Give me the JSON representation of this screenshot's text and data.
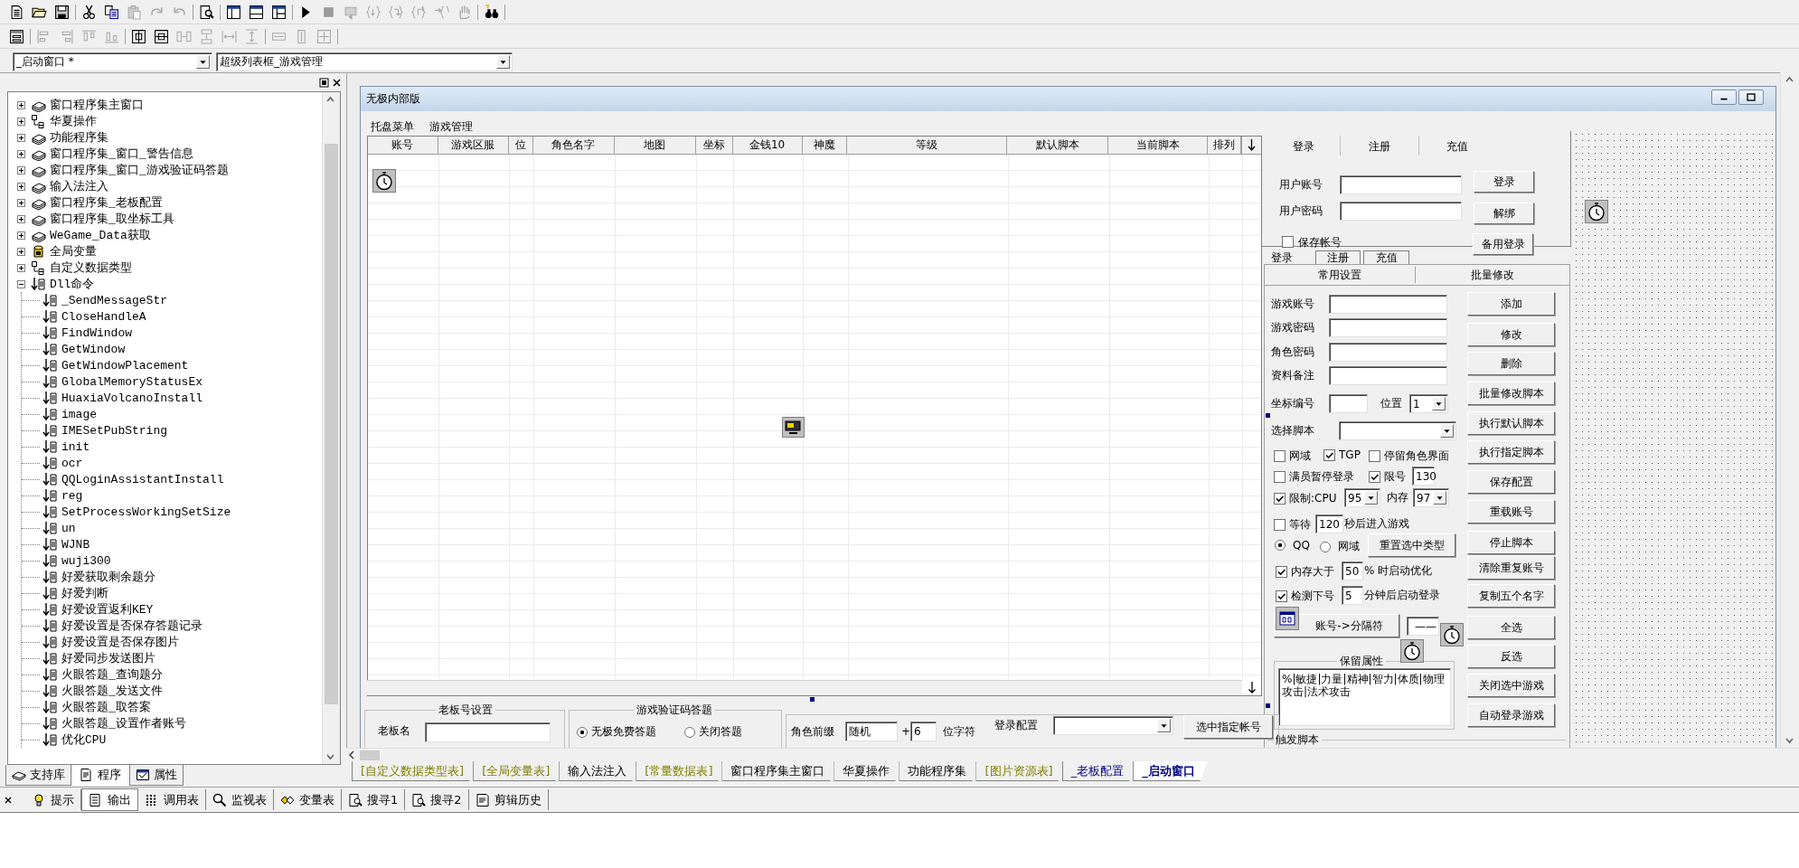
{
  "toolbars": [
    {
      "groups": [
        [
          {
            "kind": "new",
            "disabled": false
          },
          {
            "kind": "open",
            "disabled": false
          },
          {
            "kind": "save",
            "disabled": false
          }
        ],
        [
          {
            "kind": "cut",
            "disabled": false
          },
          {
            "kind": "copy",
            "disabled": false
          },
          {
            "kind": "paste",
            "disabled": true
          },
          {
            "kind": "redo",
            "disabled": true
          },
          {
            "kind": "undo",
            "disabled": true
          }
        ],
        [
          {
            "kind": "preview",
            "disabled": false
          }
        ],
        [
          {
            "kind": "layout-left",
            "disabled": false
          },
          {
            "kind": "layout-top",
            "disabled": false
          },
          {
            "kind": "layout-split",
            "disabled": false
          }
        ],
        [
          {
            "kind": "run",
            "disabled": false
          },
          {
            "kind": "stop",
            "disabled": true
          },
          {
            "kind": "step",
            "disabled": true
          },
          {
            "kind": "step-into",
            "disabled": true
          },
          {
            "kind": "step-over",
            "disabled": true
          },
          {
            "kind": "step-out",
            "disabled": true
          },
          {
            "kind": "run-to",
            "disabled": true
          },
          {
            "kind": "hand",
            "disabled": true
          }
        ],
        [
          {
            "kind": "find",
            "disabled": false
          }
        ]
      ]
    },
    {
      "groups": [
        [
          {
            "kind": "form",
            "disabled": false
          }
        ],
        [
          {
            "kind": "align-left",
            "disabled": true
          },
          {
            "kind": "align-right",
            "disabled": true
          },
          {
            "kind": "align-top",
            "disabled": true
          },
          {
            "kind": "align-bottom",
            "disabled": true
          }
        ],
        [
          {
            "kind": "center-h",
            "disabled": false
          },
          {
            "kind": "center-v",
            "disabled": false
          },
          {
            "kind": "space-h",
            "disabled": true
          },
          {
            "kind": "space-v",
            "disabled": true
          },
          {
            "kind": "gap-h",
            "disabled": true
          },
          {
            "kind": "gap-v",
            "disabled": true
          }
        ],
        [
          {
            "kind": "same-width",
            "disabled": true
          },
          {
            "kind": "same-height",
            "disabled": true
          },
          {
            "kind": "same-size",
            "disabled": true
          }
        ]
      ]
    }
  ],
  "object_selector": {
    "value": "_启动窗口 *"
  },
  "member_selector": {
    "value": "超级列表框_游戏管理"
  },
  "tree": [
    {
      "label": "窗口程序集主窗口",
      "kind": "module",
      "expanded": false
    },
    {
      "label": "华夏操作",
      "kind": "class",
      "expanded": false
    },
    {
      "label": "功能程序集",
      "kind": "module",
      "expanded": false
    },
    {
      "label": "窗口程序集_窗口_警告信息",
      "kind": "module",
      "expanded": false
    },
    {
      "label": "窗口程序集_窗口_游戏验证码答题",
      "kind": "module",
      "expanded": false
    },
    {
      "label": "输入法注入",
      "kind": "module",
      "expanded": false
    },
    {
      "label": "窗口程序集_老板配置",
      "kind": "module",
      "expanded": false
    },
    {
      "label": "窗口程序集_取坐标工具",
      "kind": "module",
      "expanded": false
    },
    {
      "label": "WeGame_Data获取",
      "kind": "module",
      "expanded": false
    },
    {
      "label": "全局变量",
      "kind": "global",
      "expanded": false
    },
    {
      "label": "自定义数据类型",
      "kind": "class",
      "expanded": false
    },
    {
      "label": "Dll命令",
      "kind": "dll",
      "expanded": true,
      "children": [
        {
          "label": "_SendMessageStr",
          "kind": "dll-command"
        },
        {
          "label": "CloseHandleA",
          "kind": "dll-command"
        },
        {
          "label": "FindWindow",
          "kind": "dll-command"
        },
        {
          "label": "GetWindow",
          "kind": "dll-command"
        },
        {
          "label": "GetWindowPlacement",
          "kind": "dll-command"
        },
        {
          "label": "GlobalMemoryStatusEx",
          "kind": "dll-command"
        },
        {
          "label": "HuaxiaVolcanoInstall",
          "kind": "dll-command"
        },
        {
          "label": "image",
          "kind": "dll-command"
        },
        {
          "label": "IMESetPubString",
          "kind": "dll-command"
        },
        {
          "label": "init",
          "kind": "dll-command"
        },
        {
          "label": "ocr",
          "kind": "dll-command"
        },
        {
          "label": "QQLoginAssistantInstall",
          "kind": "dll-command"
        },
        {
          "label": "reg",
          "kind": "dll-command"
        },
        {
          "label": "SetProcessWorkingSetSize",
          "kind": "dll-command"
        },
        {
          "label": "un",
          "kind": "dll-command"
        },
        {
          "label": "WJNB",
          "kind": "dll-command"
        },
        {
          "label": "wuji300",
          "kind": "dll-command"
        },
        {
          "label": "好爱获取剩余题分",
          "kind": "dll-command"
        },
        {
          "label": "好爱判断",
          "kind": "dll-command"
        },
        {
          "label": "好爱设置返利KEY",
          "kind": "dll-command"
        },
        {
          "label": "好爱设置是否保存答题记录",
          "kind": "dll-command"
        },
        {
          "label": "好爱设置是否保存图片",
          "kind": "dll-command"
        },
        {
          "label": "好爱同步发送图片",
          "kind": "dll-command"
        },
        {
          "label": "火眼答题_查询题分",
          "kind": "dll-command"
        },
        {
          "label": "火眼答题_发送文件",
          "kind": "dll-command"
        },
        {
          "label": "火眼答题_取答案",
          "kind": "dll-command"
        },
        {
          "label": "火眼答题_设置作者账号",
          "kind": "dll-command"
        },
        {
          "label": "优化CPU",
          "kind": "dll-command"
        }
      ]
    }
  ],
  "left_tabs": [
    {
      "label": "支持库",
      "kind": "library",
      "selected": false
    },
    {
      "label": "程序",
      "kind": "program",
      "selected": true
    },
    {
      "label": "属性",
      "kind": "properties",
      "selected": false
    }
  ],
  "form": {
    "title": "无极内部版",
    "menu": [
      "托盘菜单",
      "游戏管理"
    ],
    "list": {
      "columns": [
        "账号",
        "游戏区服",
        "位",
        "角色名字",
        "地图",
        "坐标",
        "金钱10",
        "神魔",
        "等级",
        "默认脚本",
        "当前脚本",
        "排列"
      ]
    },
    "login_panel": {
      "tabs": [
        "登录",
        "注册",
        "充值"
      ],
      "fields": [
        {
          "label": "用户账号"
        },
        {
          "label": "用户密码"
        }
      ],
      "buttons": [
        "登录",
        "解绑",
        "备用登录"
      ],
      "remember": {
        "label": "保存帐号",
        "checked": false
      },
      "mini_tabs": [
        {
          "label": "登录",
          "selected": true
        },
        {
          "label": "注册",
          "selected": false
        },
        {
          "label": "充值",
          "selected": false
        }
      ]
    },
    "settings_panel": {
      "tabs": [
        "常用设置",
        "批量修改"
      ],
      "fields": [
        {
          "label": "游戏账号"
        },
        {
          "label": "游戏密码"
        },
        {
          "label": "角色密码"
        },
        {
          "label": "资料备注"
        }
      ],
      "coord": {
        "label": "坐标编号",
        "position_label": "位置",
        "position_value": "1"
      },
      "script": {
        "label": "选择脚本"
      },
      "options": [
        {
          "kind": "checkbox",
          "label": "网域",
          "checked": false
        },
        {
          "kind": "checkbox",
          "label": "TGP",
          "checked": true
        },
        {
          "kind": "checkbox",
          "label": "停留角色界面",
          "checked": false
        },
        {
          "kind": "checkbox",
          "label": "满员暂停登录",
          "checked": false
        },
        {
          "kind": "checkbox",
          "label": "限号",
          "checked": true
        },
        {
          "kind": "field",
          "value": "130"
        },
        {
          "kind": "checkbox",
          "label": "限制:CPU",
          "checked": true
        },
        {
          "kind": "combo",
          "value": "95"
        },
        {
          "kind": "label",
          "label": "内存"
        },
        {
          "kind": "combo",
          "value": "97"
        },
        {
          "kind": "checkbox",
          "label": "等待",
          "checked": false
        },
        {
          "kind": "field",
          "value": "120"
        },
        {
          "kind": "label",
          "label": "秒后进入游戏"
        },
        {
          "kind": "radio",
          "label": "QQ",
          "selected": true
        },
        {
          "kind": "radio",
          "label": "网域",
          "selected": false
        },
        {
          "kind": "button",
          "label": "重置选中类型"
        },
        {
          "kind": "checkbox",
          "label": "内存大于",
          "checked": true
        },
        {
          "kind": "field",
          "value": "50"
        },
        {
          "kind": "label",
          "label": "% 时启动优化"
        },
        {
          "kind": "checkbox",
          "label": "检测下号",
          "checked": true
        },
        {
          "kind": "field",
          "value": "5"
        },
        {
          "kind": "label",
          "label": "分钟后启动登录"
        },
        {
          "kind": "button",
          "label": "账号->分隔符"
        },
        {
          "kind": "field",
          "value": "——"
        }
      ],
      "keep_group": {
        "title": "保留属性",
        "text": "%|敏捷|力量|精神|智力|体质|物理攻击|法术攻击"
      },
      "trigger_group": {
        "title": "触发脚本"
      },
      "buttons": [
        "添加",
        "修改",
        "删除",
        "批量修改脚本",
        "执行默认脚本",
        "执行指定脚本",
        "保存配置",
        "重载账号",
        "停止脚本",
        "清除重复账号",
        "复制五个名字",
        "全选",
        "反选",
        "关闭选中游戏",
        "自动登录游戏"
      ]
    },
    "boss_group": {
      "title": "老板号设置",
      "label": "老板名"
    },
    "captcha_group": {
      "title": "游戏验证码答题",
      "options": [
        {
          "label": "无极免费答题",
          "selected": true
        },
        {
          "label": "关闭答题",
          "selected": false
        }
      ]
    },
    "prefix": {
      "label": "角色前缀",
      "value": "随机",
      "plus": "+",
      "length": "6",
      "unit": "位字符"
    },
    "login_config": {
      "label": "登录配置"
    },
    "select_button": "选中指定帐号"
  },
  "doc_tabs": [
    {
      "label": "[自定义数据类型表]",
      "kind": "table",
      "selected": false
    },
    {
      "label": "[全局变量表]",
      "kind": "table",
      "selected": false
    },
    {
      "label": "输入法注入",
      "kind": "module",
      "selected": false
    },
    {
      "label": "[常量数据表]",
      "kind": "table",
      "selected": false
    },
    {
      "label": "窗口程序集主窗口",
      "kind": "module",
      "selected": false
    },
    {
      "label": "华夏操作",
      "kind": "module",
      "selected": false
    },
    {
      "label": "功能程序集",
      "kind": "module",
      "selected": false
    },
    {
      "label": "[图片资源表]",
      "kind": "table",
      "selected": false
    },
    {
      "label": "_老板配置",
      "kind": "window",
      "selected": false
    },
    {
      "label": "_启动窗口",
      "kind": "window",
      "selected": true
    }
  ],
  "output_tabs": [
    {
      "label": "提示",
      "kind": "hint",
      "selected": false
    },
    {
      "label": "输出",
      "kind": "output",
      "selected": true
    },
    {
      "label": "调用表",
      "kind": "calls",
      "selected": false
    },
    {
      "label": "监视表",
      "kind": "watch",
      "selected": false
    },
    {
      "label": "变量表",
      "kind": "vars",
      "selected": false
    },
    {
      "label": "搜寻1",
      "kind": "search",
      "selected": false
    },
    {
      "label": "搜寻2",
      "kind": "search",
      "selected": false
    },
    {
      "label": "剪辑历史",
      "kind": "history",
      "selected": false
    }
  ]
}
